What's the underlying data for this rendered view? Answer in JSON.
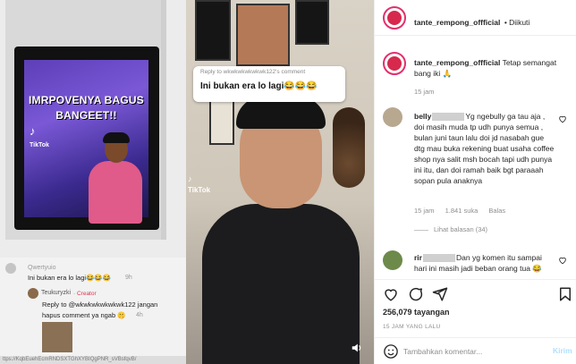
{
  "left_video": {
    "overlay_line1": "IMRPOVENYA BAGUS",
    "overlay_line2": "BANGEET!!",
    "tiktok_label": "TikTok",
    "comment1_user": "Qwertyuio",
    "comment1_text": "Ini bukan era lo lagi😂😂😂",
    "comment1_time": "9h",
    "reply_user": "Teukuryzki",
    "reply_badge": "· Creator",
    "reply_line1": "Reply to @wkwkwkwkwkwk122 jangan",
    "reply_line2": "hapus comment ya ngab 🤫",
    "reply_time": "4h",
    "url_text": "ttps://KqbEuehEcmRNDSXTGhXYBIQgPNR_sVBsfqvB/"
  },
  "right_video": {
    "reply_header": "Reply to wkwkwkwkwkwk122's comment",
    "reply_text": "Ini bukan era lo lagi😂😂😂",
    "tiktok_label": "TikTok"
  },
  "instagram": {
    "account": "tante_rempong_offficial",
    "follow_label": "• Diikuti",
    "caption_user": "tante_rempong_offficial",
    "caption_text": "Tetap semangat bang iki 🙏",
    "caption_time": "15 jam",
    "comment1": {
      "user": "belly",
      "line1": "Yg ngebully ga tau",
      "text": "aja , doi masih muda tp udh punya semua , bulan juni taun lalu doi jd nasabah gue dtg mau buka rekening buat usaha coffee shop nya salit msh bocah tapi udh punya ini itu, dan doi ramah baik bgt paraaah sopan pula anaknya",
      "time": "15 jam",
      "likes": "1.841 suka",
      "reply": "Balas",
      "view_replies": "Lihat balasan (34)"
    },
    "comment2": {
      "user": "rir",
      "line1": "Dan yg komen itu sampai",
      "text": "hari ini masih jadi beban orang tua 😂"
    },
    "likes_count": "256,079 tayangan",
    "time_ago": "15 JAM YANG LALU",
    "input_placeholder": "Tambahkan komentar...",
    "post_label": "Kirim",
    "colors": {
      "accent": "#e1306c",
      "link": "#b2dffc",
      "meta": "#8e8e8e"
    }
  }
}
